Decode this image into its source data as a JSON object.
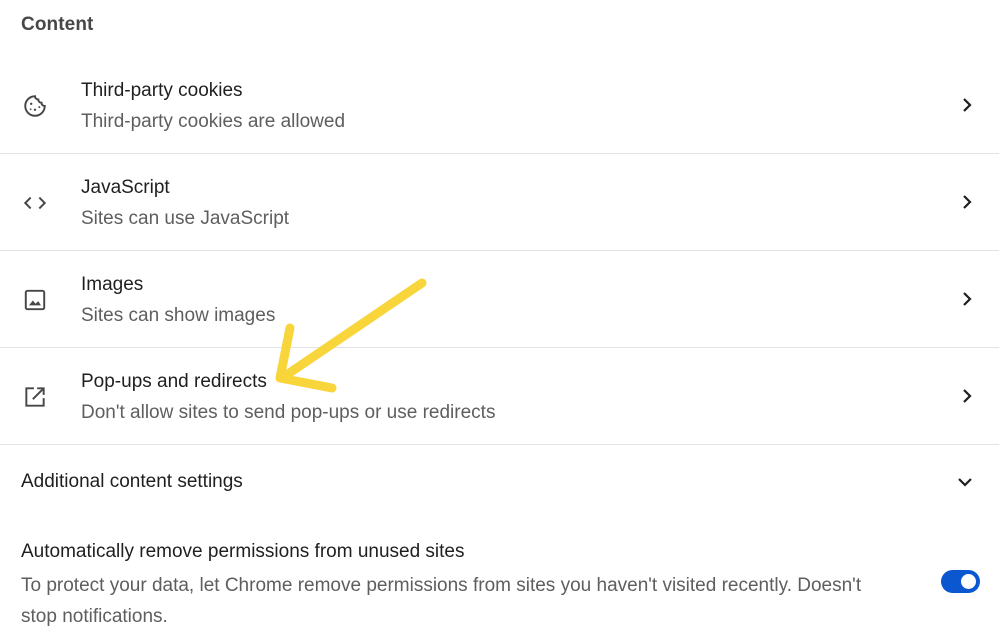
{
  "section": {
    "title": "Content"
  },
  "rows": [
    {
      "label": "Third-party cookies",
      "sublabel": "Third-party cookies are allowed",
      "icon": "cookie-icon"
    },
    {
      "label": "JavaScript",
      "sublabel": "Sites can use JavaScript",
      "icon": "code-icon"
    },
    {
      "label": "Images",
      "sublabel": "Sites can show images",
      "icon": "image-icon"
    },
    {
      "label": "Pop-ups and redirects",
      "sublabel": "Don't allow sites to send pop-ups or use redirects",
      "icon": "open-in-new-icon"
    }
  ],
  "additional": {
    "label": "Additional content settings"
  },
  "permissions": {
    "label": "Automatically remove permissions from unused sites",
    "description": "To protect your data, let Chrome remove permissions from sites you haven't visited recently. Doesn't stop notifications.",
    "toggle_on": true
  },
  "colors": {
    "accent": "#0b57d0",
    "annotation": "#f9d53c"
  }
}
